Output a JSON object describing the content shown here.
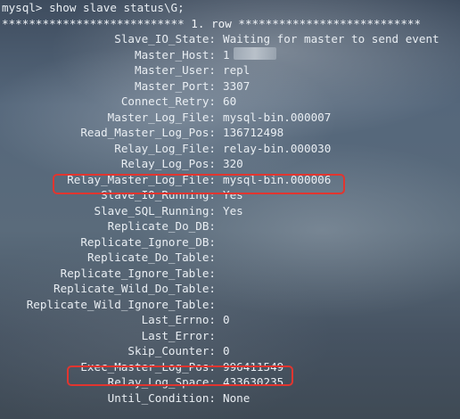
{
  "terminal": {
    "prompt": "mysql> show slave status\\G;",
    "row_banner": "*************************** 1. row ***************************",
    "rows": [
      {
        "key": "Slave_IO_State:",
        "value": "Waiting for master to send event"
      },
      {
        "key": "Master_Host:",
        "value": "1"
      },
      {
        "key": "Master_User:",
        "value": "repl"
      },
      {
        "key": "Master_Port:",
        "value": "3307"
      },
      {
        "key": "Connect_Retry:",
        "value": "60"
      },
      {
        "key": "Master_Log_File:",
        "value": "mysql-bin.000007"
      },
      {
        "key": "Read_Master_Log_Pos:",
        "value": "136712498"
      },
      {
        "key": "Relay_Log_File:",
        "value": "relay-bin.000030"
      },
      {
        "key": "Relay_Log_Pos:",
        "value": "320"
      },
      {
        "key": "Relay_Master_Log_File:",
        "value": "mysql-bin.000006"
      },
      {
        "key": "Slave_IO_Running:",
        "value": "Yes"
      },
      {
        "key": "Slave_SQL_Running:",
        "value": "Yes"
      },
      {
        "key": "Replicate_Do_DB:",
        "value": ""
      },
      {
        "key": "Replicate_Ignore_DB:",
        "value": ""
      },
      {
        "key": "Replicate_Do_Table:",
        "value": ""
      },
      {
        "key": "Replicate_Ignore_Table:",
        "value": ""
      },
      {
        "key": "Replicate_Wild_Do_Table:",
        "value": ""
      },
      {
        "key": "Replicate_Wild_Ignore_Table:",
        "value": ""
      },
      {
        "key": "Last_Errno:",
        "value": "0"
      },
      {
        "key": "Last_Error:",
        "value": ""
      },
      {
        "key": "Skip_Counter:",
        "value": "0"
      },
      {
        "key": "Exec_Master_Log_Pos:",
        "value": "996411549"
      },
      {
        "key": "Relay_Log_Space:",
        "value": "433630235"
      },
      {
        "key": "Until_Condition:",
        "value": "None"
      }
    ],
    "highlighted_keys": [
      "Relay_Master_Log_File:",
      "Exec_Master_Log_Pos:"
    ],
    "highlight_color": "#e2352f"
  }
}
